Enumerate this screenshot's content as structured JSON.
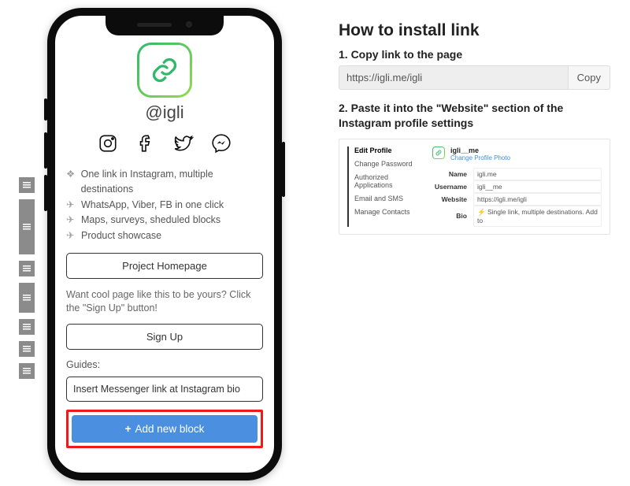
{
  "sidebar": {
    "handle_heights": [
      20,
      70,
      20,
      38,
      20,
      20,
      20
    ]
  },
  "phone": {
    "username": "@igli",
    "social": [
      "instagram-icon",
      "facebook-icon",
      "twitter-icon",
      "messenger-icon"
    ],
    "features": [
      "One link in Instagram, multiple destinations",
      "WhatsApp, Viber, FB in one click",
      "Maps, surveys, sheduled blocks",
      "Product showcase"
    ],
    "project_btn": "Project Homepage",
    "hint": "Want cool page like this to be yours? Click the \"Sign Up\" button!",
    "signup_btn": "Sign Up",
    "guides_label": "Guides:",
    "messenger_btn": "Insert Messenger link at Instagram bio",
    "add_btn": "Add new block"
  },
  "right": {
    "title": "How to install link",
    "step1": "1. Copy link to the page",
    "link": "https://igli.me/igli",
    "copy_btn": "Copy",
    "step2": "2. Paste it into the \"Website\" section of the Instagram profile settings",
    "ig_menu": [
      "Edit Profile",
      "Change Password",
      "Authorized Applications",
      "Email and SMS",
      "Manage Contacts"
    ],
    "ig_user": "igli__me",
    "ig_cpp": "Change Profile Photo",
    "ig_fields": {
      "Name": "igli.me",
      "Username": "igli__me",
      "Website": "https://igli.me/igli",
      "Bio": "⚡ Single link, multiple destinations. Add to"
    }
  }
}
